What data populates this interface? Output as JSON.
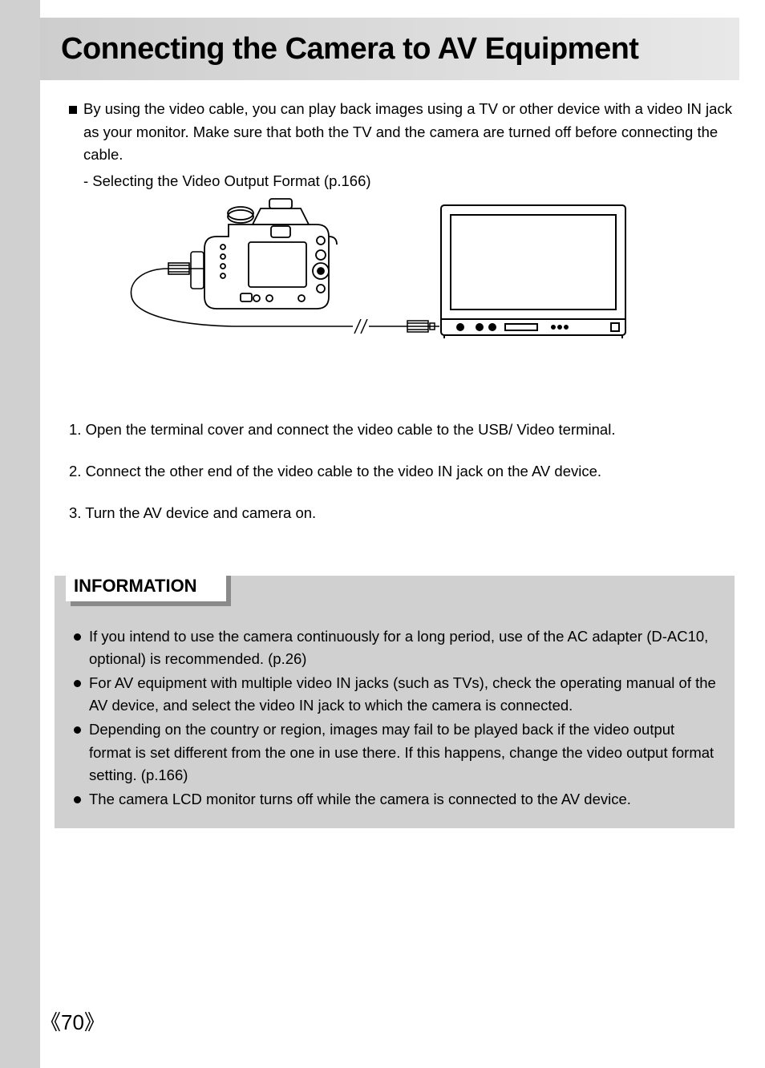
{
  "title": "Connecting the Camera to AV Equipment",
  "intro": {
    "main": "By using the video cable, you can play back images using a TV or other device with a video IN jack as your monitor. Make sure that both the TV and the camera are turned off before connecting the cable.",
    "sub": "- Selecting the Video Output Format (p.166)"
  },
  "steps": [
    "1. Open the terminal cover and connect the video cable to the USB/ Video terminal.",
    "2. Connect the other end of the video cable to the video IN jack on the AV device.",
    "3. Turn the AV device and camera on."
  ],
  "info": {
    "heading": "INFORMATION",
    "items": [
      "If you intend to use the camera continuously for a long period, use of the AC adapter (D-AC10, optional) is recommended. (p.26)",
      "For AV equipment with multiple video IN jacks (such as TVs), check the operating manual of the AV device, and select the video IN jack to which the camera is connected.",
      "Depending on the country or region, images may fail to be played back if the video output format is set different from the one in use there. If this happens, change the video output format setting. (p.166)",
      "The camera LCD monitor turns off while the camera is connected to the AV device."
    ]
  },
  "page_number_left": "《70》"
}
